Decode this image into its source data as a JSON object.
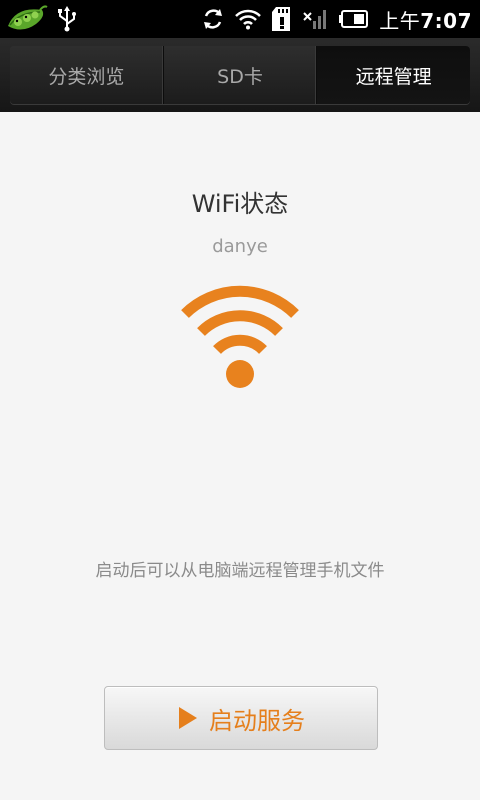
{
  "status_bar": {
    "time_prefix": "上午",
    "time": "7:07",
    "icons": [
      "app-pea-icon",
      "usb-icon",
      "sync-icon",
      "wifi-icon",
      "sd-card-icon",
      "signal-icon",
      "battery-icon"
    ]
  },
  "tabs": [
    {
      "label": "分类浏览",
      "active": false
    },
    {
      "label": "SD卡",
      "active": false
    },
    {
      "label": "远程管理",
      "active": true
    }
  ],
  "wifi": {
    "title": "WiFi状态",
    "network_name": "danye",
    "icon": "wifi-signal-icon",
    "color": "#e8821e"
  },
  "hint": "启动后可以从电脑端远程管理手机文件",
  "start_button": {
    "label": "启动服务",
    "icon": "play-icon",
    "color": "#e57f1c"
  },
  "colors": {
    "accent": "#e8821e",
    "status_bar_bg": "#000000",
    "content_bg": "#f5f5f5"
  }
}
